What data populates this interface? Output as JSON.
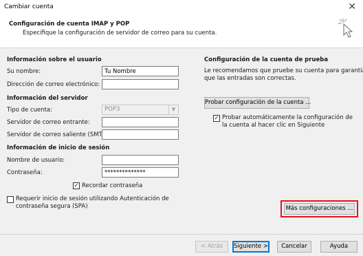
{
  "window": {
    "title": "Cambiar cuenta"
  },
  "header": {
    "title": "Configuración de cuenta IMAP y POP",
    "subtitle": "Especifique la configuración de servidor de correo para su cuenta."
  },
  "user_info": {
    "heading": "Información sobre el usuario",
    "name_label": "Su nombre:",
    "name_value": "Tu Nombre",
    "email_label": "Dirección de correo electrónico:",
    "email_value": ""
  },
  "server_info": {
    "heading": "Información del servidor",
    "account_type_label": "Tipo de cuenta:",
    "account_type_value": "POP3",
    "incoming_label": "Servidor de correo entrante:",
    "incoming_value": "",
    "outgoing_label": "Servidor de correo saliente (SMTP):",
    "outgoing_value": ""
  },
  "login_info": {
    "heading": "Información de inicio de sesión",
    "username_label": "Nombre de usuario:",
    "username_value": "",
    "password_label": "Contraseña:",
    "password_value": "**************",
    "remember_label": "Recordar contraseña",
    "remember_checked": true,
    "spa_label_line1": "Requerir inicio de sesión utilizando Autenticación de",
    "spa_label_line2": "contraseña segura (SPA)",
    "spa_checked": false
  },
  "test": {
    "heading": "Configuración de la cuenta de prueba",
    "description_line1": "Le recomendamos que pruebe su cuenta para garantizar",
    "description_line2": "que las entradas son correctas.",
    "test_button": "Probar configuración de la cuenta ...",
    "auto_test_line1": "Probar automáticamente la configuración de",
    "auto_test_line2": "la cuenta al hacer clic en Siguiente",
    "auto_test_checked": true,
    "more_settings_button": "Más configuraciones ..."
  },
  "footer": {
    "back": "< Atrás",
    "next": "Siguiente >",
    "cancel": "Cancelar",
    "help": "Ayuda"
  },
  "colors": {
    "highlight": "#e0141e",
    "primary_border": "#0078d7"
  },
  "icons": {
    "close": "close-icon",
    "header": "sparkle-cursor-icon",
    "check": "checkmark-icon",
    "dropdown": "chevron-down-icon"
  }
}
